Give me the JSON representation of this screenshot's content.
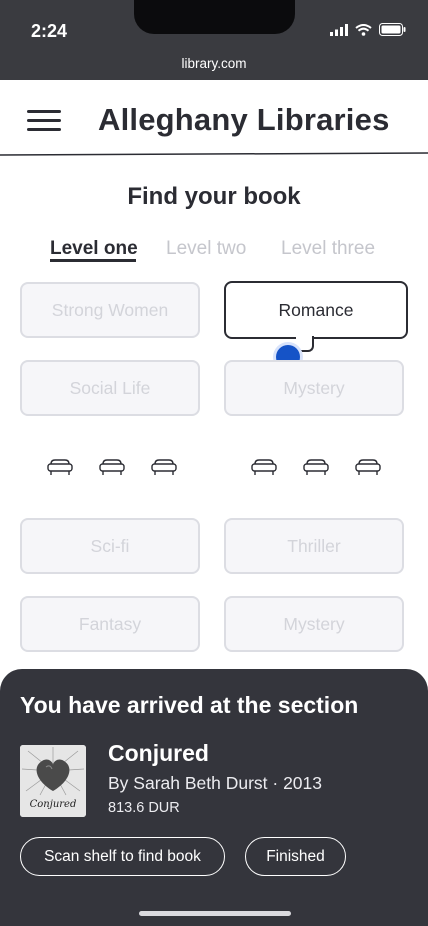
{
  "status_bar": {
    "time": "2:24",
    "url": "library.com"
  },
  "header": {
    "title": "Alleghany Libraries"
  },
  "main": {
    "title": "Find your book",
    "tabs": [
      {
        "label": "Level one",
        "active": true
      },
      {
        "label": "Level two",
        "active": false
      },
      {
        "label": "Level three",
        "active": false
      }
    ],
    "genres": [
      {
        "label": "Strong Women"
      },
      {
        "label": "Romance",
        "selected": true
      },
      {
        "label": "Social Life"
      },
      {
        "label": "Mystery"
      },
      {
        "label": "Sci-fi"
      },
      {
        "label": "Thriller"
      },
      {
        "label": "Fantasy"
      },
      {
        "label": "Mystery"
      }
    ]
  },
  "sheet": {
    "title": "You have arrived at the section",
    "book": {
      "title": "Conjured",
      "meta": "By Sarah Beth Durst · 2013",
      "duration": "813.6 DUR",
      "cover_text": "Conjured"
    },
    "actions": {
      "scan": "Scan shelf to find book",
      "finished": "Finished"
    }
  },
  "colors": {
    "accent": "#1553c7",
    "dark": "#2b2c33",
    "sheet": "#34353c"
  }
}
